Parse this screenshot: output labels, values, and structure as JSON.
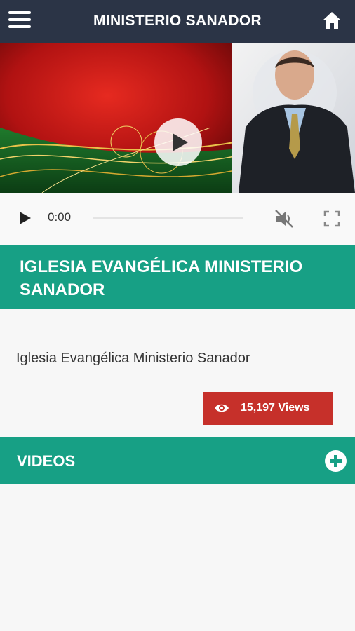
{
  "header": {
    "title": "MINISTERIO SANADOR",
    "menu_icon": "hamburger-menu-icon",
    "home_icon": "home-icon"
  },
  "player": {
    "current_time": "0:00",
    "progress": 0,
    "muted": true
  },
  "church": {
    "title": "IGLESIA EVANGÉLICA MINISTERIO SANADOR",
    "description": "Iglesia Evangélica Ministerio Sanador",
    "views_label": "15,197 Views"
  },
  "videos_section": {
    "label": "VIDEOS"
  },
  "colors": {
    "header_bg": "#2b3446",
    "accent": "#17a085",
    "views_bg": "#c6302a"
  }
}
